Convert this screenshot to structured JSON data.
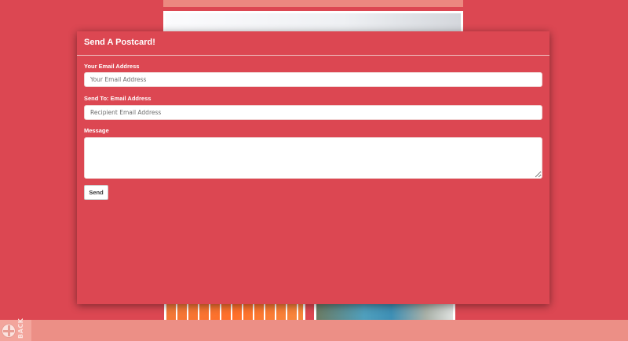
{
  "modal": {
    "title": "Send A Postcard!",
    "fields": [
      {
        "label": "Your Email Address",
        "placeholder": "Your Email Address",
        "value": ""
      },
      {
        "label": "Send To: Email Address",
        "placeholder": "Recipient Email Address",
        "value": ""
      }
    ],
    "message": {
      "label": "Message",
      "value": ""
    },
    "send_label": "Send"
  },
  "footer": {
    "back_label": "BACK",
    "back_icon": "globe-icon"
  },
  "colors": {
    "page_background": "#dc4752",
    "footer_bar": "#ec8f86",
    "modal_divider": "#f0c6c6"
  }
}
